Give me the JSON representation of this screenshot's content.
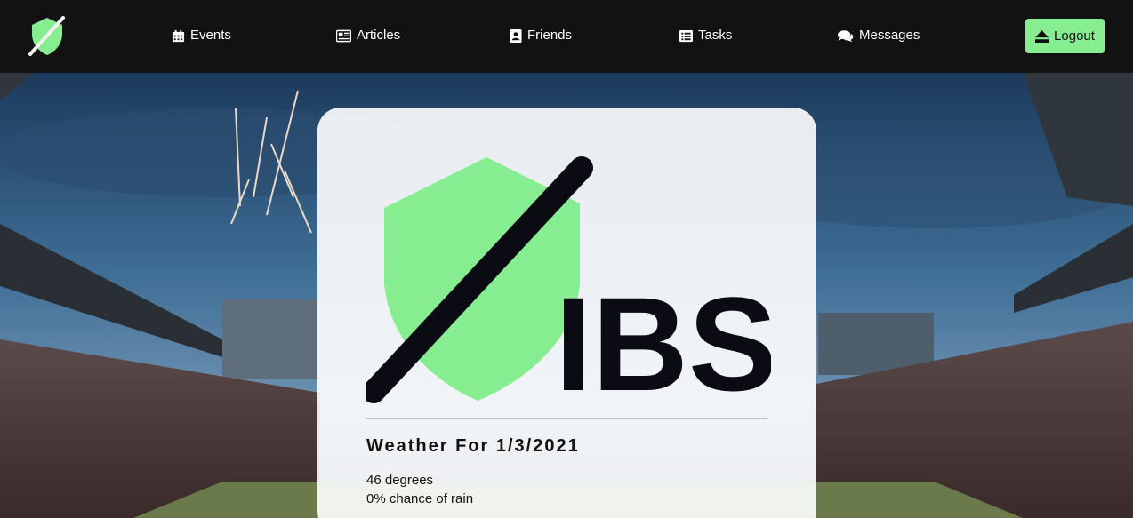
{
  "nav": {
    "logo_icon": "ibs-shield-bat-logo",
    "items": [
      {
        "label": "Events",
        "icon": "calendar-icon"
      },
      {
        "label": "Articles",
        "icon": "newspaper-icon"
      },
      {
        "label": "Friends",
        "icon": "address-book-icon"
      },
      {
        "label": "Tasks",
        "icon": "list-icon"
      },
      {
        "label": "Messages",
        "icon": "comments-icon"
      }
    ],
    "logout_label": "Logout",
    "logout_icon": "eject-icon"
  },
  "card": {
    "logo_text": "IBS",
    "weather_title": "Weather For 1/3/2021",
    "temperature": "46 degrees",
    "rain_chance": "0% chance of rain"
  },
  "colors": {
    "accent_green": "#86ee91",
    "navbar_bg": "#121212",
    "bat_color": "#0b0b14"
  }
}
